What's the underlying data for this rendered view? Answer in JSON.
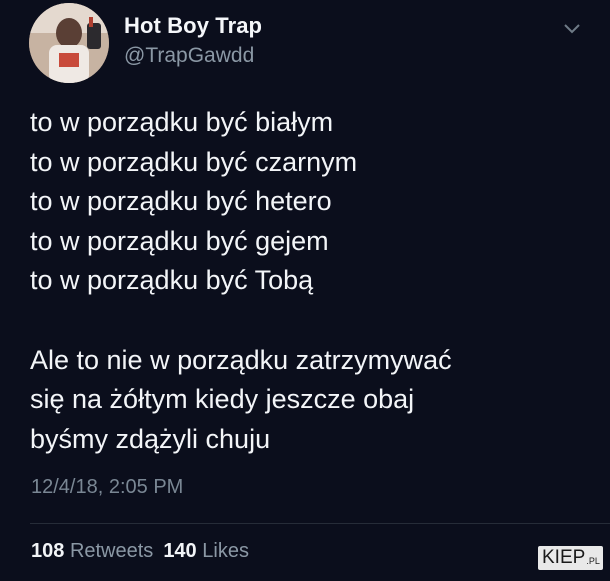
{
  "tweet": {
    "display_name": "Hot Boy Trap",
    "handle": "@TrapGawdd",
    "lines_part1": [
      "to w porządku być białym",
      "to w porządku być czarnym",
      "to w porządku być hetero",
      "to w porządku być gejem",
      "to w porządku być Tobą"
    ],
    "lines_part2": [
      "Ale to nie w porządku zatrzymywać",
      "się na żółtym kiedy jeszcze obaj",
      "byśmy zdążyli chuju"
    ],
    "timestamp": "12/4/18, 2:05 PM",
    "retweets_count": "108",
    "retweets_label": "Retweets",
    "likes_count": "140",
    "likes_label": "Likes"
  },
  "watermark": {
    "text": "KIEP",
    "suffix": ".PL"
  },
  "icons": {
    "chevron": "chevron-down-icon",
    "avatar": "avatar"
  },
  "colors": {
    "background": "#0b0e1c",
    "text_primary": "#f2f4f7",
    "text_secondary": "#8b98a5"
  }
}
